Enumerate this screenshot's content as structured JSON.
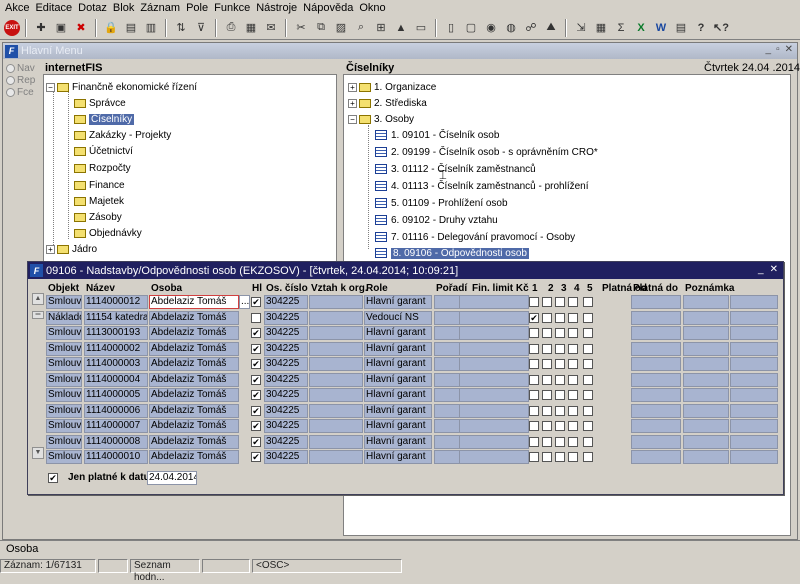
{
  "menu": [
    "Akce",
    "Editace",
    "Dotaz",
    "Blok",
    "Záznam",
    "Pole",
    "Funkce",
    "Nástroje",
    "Nápověda",
    "Okno"
  ],
  "main_window": {
    "title": "Hlavní Menu",
    "app_label": "internetFIS",
    "date": "Čtvrtek 24.04 .2014",
    "catalog_label": "Číselníky"
  },
  "side_nav": [
    "Nav",
    "Rep",
    "Fce"
  ],
  "left_tree": [
    {
      "label": "Finančně ekonomické řízení"
    },
    {
      "label": "Správce"
    },
    {
      "label": "Číselníky"
    },
    {
      "label": "Zakázky - Projekty"
    },
    {
      "label": "Účetnictví"
    },
    {
      "label": "Rozpočty"
    },
    {
      "label": "Finance"
    },
    {
      "label": "Majetek"
    },
    {
      "label": "Zásoby"
    },
    {
      "label": "Objednávky"
    },
    {
      "label": "Jádro"
    }
  ],
  "right_tree": [
    {
      "label": "1. Organizace"
    },
    {
      "label": "2. Střediska"
    },
    {
      "label": "3. Osoby"
    },
    {
      "label": "1. 09101 - Číselník osob"
    },
    {
      "label": "2. 09199 - Číselník osob - s oprávněním CRO*"
    },
    {
      "label": "3. 01112 - Číselník zaměstnanců"
    },
    {
      "label": "4. 01113 - Číselník zaměstnanců - prohlížení"
    },
    {
      "label": "5. 01109 - Prohlížení osob"
    },
    {
      "label": "6. 09102 - Druhy vztahu"
    },
    {
      "label": "7. 01116 - Delegování pravomocí - Osoby"
    },
    {
      "label": "8. 09106 - Odpovědnosti osob"
    }
  ],
  "subwindow": {
    "title": "09106 - Nadstavby/Odpovědnosti osob (EKZOSOV) - [čtvrtek, 24.04.2014; 10:09:21]",
    "headers": [
      "Objekt",
      "Název",
      "Osoba",
      "Hl",
      "Os. číslo",
      "Vztah k org.",
      "Role",
      "Pořadí",
      "Fin. limit Kč",
      "1",
      "2",
      "3",
      "4",
      "5",
      "Platná od",
      "Platná do",
      "Poznámka"
    ],
    "rows": [
      {
        "objekt": "Smlouvy",
        "nazev": "1114000012",
        "osoba": "Abdelaziz Tomáš",
        "hl": "✔",
        "cislo": "304225",
        "role": "Hlavní garant",
        "c1": "",
        "c2": ""
      },
      {
        "objekt": "Náklado",
        "nazev": "11154 katedra s",
        "osoba": "Abdelaziz Tomáš",
        "hl": "",
        "cislo": "304225",
        "role": "Vedoucí NS",
        "c1": "✔",
        "c2": ""
      },
      {
        "objekt": "Smlouvy",
        "nazev": "1113000193",
        "osoba": "Abdelaziz Tomáš",
        "hl": "✔",
        "cislo": "304225",
        "role": "Hlavní garant",
        "c1": "",
        "c2": ""
      },
      {
        "objekt": "Smlouvy",
        "nazev": "1114000002",
        "osoba": "Abdelaziz Tomáš",
        "hl": "✔",
        "cislo": "304225",
        "role": "Hlavní garant",
        "c1": "",
        "c2": ""
      },
      {
        "objekt": "Smlouvy",
        "nazev": "1114000003",
        "osoba": "Abdelaziz Tomáš",
        "hl": "✔",
        "cislo": "304225",
        "role": "Hlavní garant",
        "c1": "",
        "c2": ""
      },
      {
        "objekt": "Smlouvy",
        "nazev": "1114000004",
        "osoba": "Abdelaziz Tomáš",
        "hl": "✔",
        "cislo": "304225",
        "role": "Hlavní garant",
        "c1": "",
        "c2": ""
      },
      {
        "objekt": "Smlouvy",
        "nazev": "1114000005",
        "osoba": "Abdelaziz Tomáš",
        "hl": "✔",
        "cislo": "304225",
        "role": "Hlavní garant",
        "c1": "",
        "c2": ""
      },
      {
        "objekt": "Smlouvy",
        "nazev": "1114000006",
        "osoba": "Abdelaziz Tomáš",
        "hl": "✔",
        "cislo": "304225",
        "role": "Hlavní garant",
        "c1": "",
        "c2": ""
      },
      {
        "objekt": "Smlouvy",
        "nazev": "1114000007",
        "osoba": "Abdelaziz Tomáš",
        "hl": "✔",
        "cislo": "304225",
        "role": "Hlavní garant",
        "c1": "",
        "c2": ""
      },
      {
        "objekt": "Smlouvy",
        "nazev": "1114000008",
        "osoba": "Abdelaziz Tomáš",
        "hl": "✔",
        "cislo": "304225",
        "role": "Hlavní garant",
        "c1": "",
        "c2": ""
      },
      {
        "objekt": "Smlouvy",
        "nazev": "1114000010",
        "osoba": "Abdelaziz Tomáš",
        "hl": "✔",
        "cislo": "304225",
        "role": "Hlavní garant",
        "c1": "",
        "c2": ""
      }
    ],
    "filter_label": "Jen platné k datu",
    "filter_checked": "✔",
    "filter_date": "24.04.2014",
    "lov_button": "..."
  },
  "status": {
    "field": "Osoba",
    "record": "Záznam: 1/67131",
    "mode": "Seznam hodn...",
    "osc": "<OSC>"
  }
}
